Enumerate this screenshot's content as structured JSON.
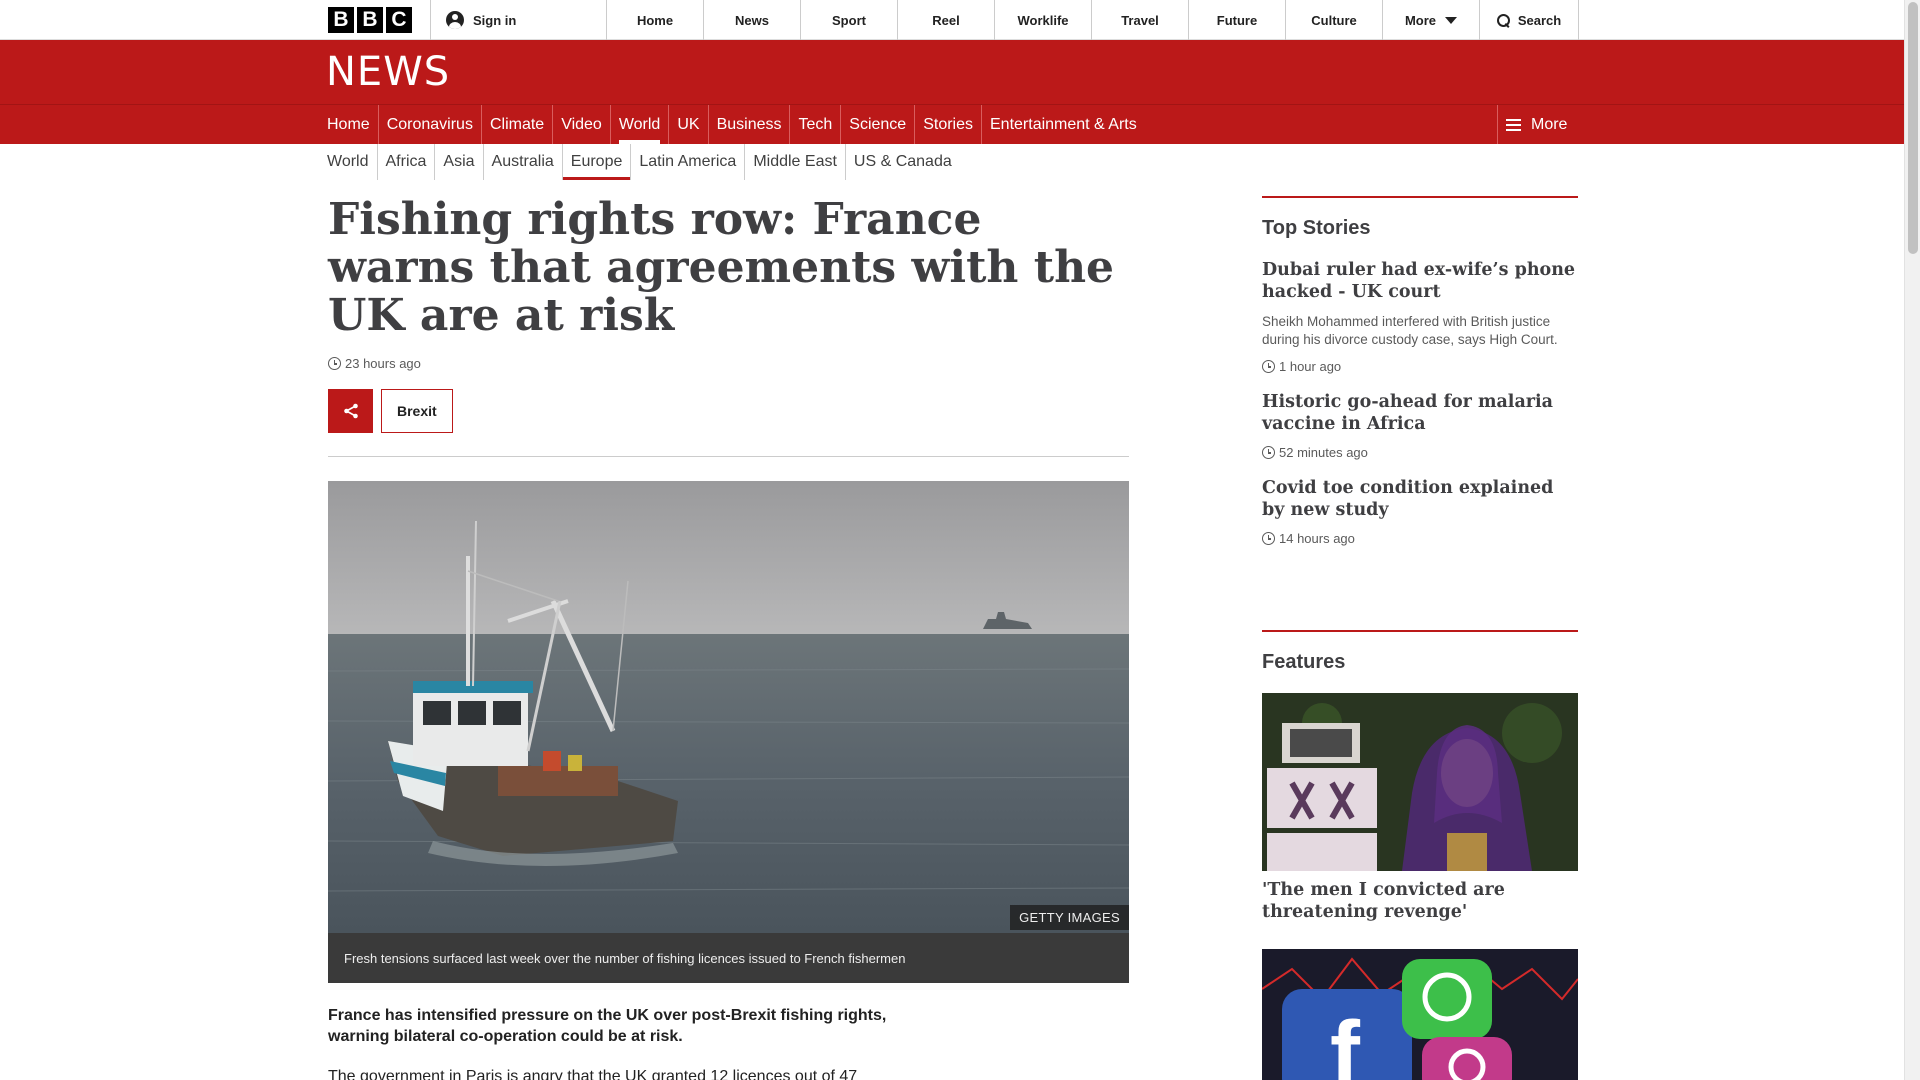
{
  "topbar": {
    "logo_letters": [
      "B",
      "B",
      "C"
    ],
    "signin_label": "Sign in",
    "nav": [
      "Home",
      "News",
      "Sport",
      "Reel",
      "Worklife",
      "Travel",
      "Future",
      "Culture"
    ],
    "more_label": "More",
    "search_label": "Search"
  },
  "news_header": {
    "wordmark": "NEWS",
    "sections": [
      "Home",
      "Coronavirus",
      "Climate",
      "Video",
      "World",
      "UK",
      "Business",
      "Tech",
      "Science",
      "Stories",
      "Entertainment & Arts"
    ],
    "active_section": "World",
    "more_label": "More"
  },
  "subnav": {
    "items": [
      "World",
      "Africa",
      "Asia",
      "Australia",
      "Europe",
      "Latin America",
      "Middle East",
      "US & Canada"
    ],
    "active": "Europe"
  },
  "article": {
    "headline": "Fishing rights row: France warns that agreements with the UK are at risk",
    "timestamp": "23 hours ago",
    "tag": "Brexit",
    "image_credit": "GETTY IMAGES",
    "image_caption": "Fresh tensions surfaced last week over the number of fishing licences issued to French fishermen",
    "lede": "France has intensified pressure on the UK over post-Brexit fishing rights, warning bilateral co-operation could be at risk.",
    "paragraph_start": "The government in Paris is angry that the UK granted 12 licences out of 47"
  },
  "sidebar": {
    "top_stories_title": "Top Stories",
    "top_stories": [
      {
        "title": "Dubai ruler had ex-wife’s phone hacked - UK court",
        "summary": "Sheikh Mohammed interfered with British justice during his divorce custody case, says High Court.",
        "time": "1 hour ago"
      },
      {
        "title": "Historic go-ahead for malaria vaccine in Africa",
        "summary": "",
        "time": "52 minutes ago"
      },
      {
        "title": "Covid toe condition explained by new study",
        "summary": "",
        "time": "14 hours ago"
      }
    ],
    "features_title": "Features",
    "features": [
      {
        "title": "'The men I convicted are threatening revenge'"
      }
    ]
  },
  "colors": {
    "bbc_red": "#bb1919",
    "headline_text": "#3f3f42",
    "meta_text": "#5a5a5a"
  }
}
